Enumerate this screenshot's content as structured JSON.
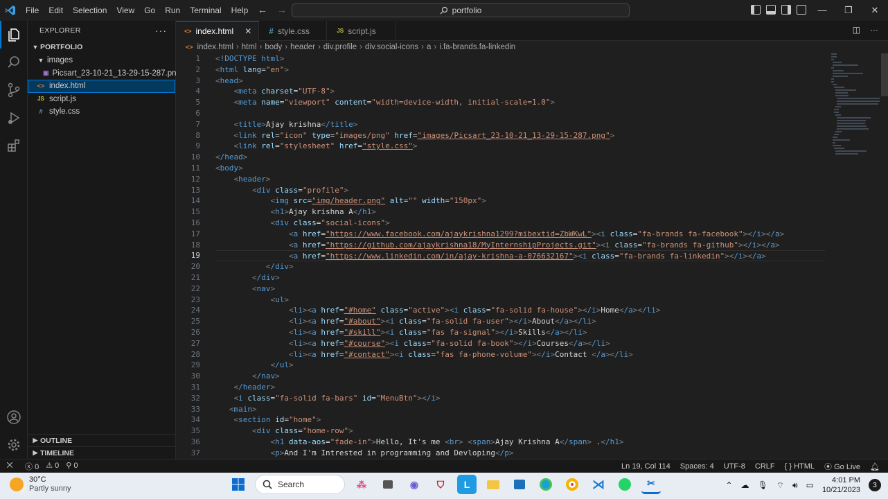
{
  "titlebar": {
    "menu": [
      "File",
      "Edit",
      "Selection",
      "View",
      "Go",
      "Run",
      "Terminal",
      "Help"
    ],
    "search_text": "portfolio"
  },
  "sidebar": {
    "title": "EXPLORER",
    "project": "PORTFOLIO",
    "folder_images": "images",
    "image_file": "Picsart_23-10-21_13-29-15-287.png",
    "files": [
      "index.html",
      "script.js",
      "style.css"
    ],
    "outline": "OUTLINE",
    "timeline": "TIMELINE"
  },
  "tabs": [
    {
      "label": "index.html",
      "icon": "html-file-icon"
    },
    {
      "label": "style.css",
      "icon": "css-file-icon"
    },
    {
      "label": "script.js",
      "icon": "js-file-icon"
    }
  ],
  "breadcrumbs": [
    "index.html",
    "html",
    "body",
    "header",
    "div.profile",
    "div.social-icons",
    "a",
    "i.fa-brands.fa-linkedin"
  ],
  "editor": {
    "current_line": 19,
    "lines": [
      "<!DOCTYPE html>",
      "<html lang=\"en\">",
      "<head>",
      "    <meta charset=\"UTF-8\">",
      "    <meta name=\"viewport\" content=\"width=device-width, initial-scale=1.0\">",
      "",
      "    <title>Ajay krishna</title>",
      "    <link rel=\"icon\" type=\"images/png\" href=\"images/Picsart_23-10-21_13-29-15-287.png\">",
      "    <link rel=\"stylesheet\" href=\"style.css\">",
      "</head>",
      "<body>",
      "    <header>",
      "        <div class=\"profile\">",
      "            <img src=\"img/header.png\" alt=\"\" width=\"150px\">",
      "            <h1>Ajay krishna A</h1>",
      "            <div class=\"social-icons\">",
      "                <a href=\"https://www.facebook.com/ajaykrishna1299?mibextid=ZbWKwL\"><i class=\"fa-brands fa-facebook\"></i></a>",
      "                <a href=\"https://github.com/ajaykrishna18/MyInternshipProjects.git\"><i class=\"fa-brands fa-github\"></i></a>",
      "                <a href=\"https://www.linkedin.com/in/ajay-krishna-a-076632167\"><i class=\"fa-brands fa-linkedin\"></i></a>",
      "           </div>",
      "        </div>",
      "        <nav>",
      "            <ul>",
      "                <li><a href=\"#home\" class=\"active\"><i class=\"fa-solid fa-house\"></i>Home</a></li>",
      "                <li><a href=\"#about\"><i class=\"fa-solid fa-user\"></i>About</a></li>",
      "                <li><a href=\"#skill\"><i class=\"fas fa-signal\"></i>Skills</a></li>",
      "                <li><a href=\"#course\"><i class=\"fa-solid fa-book\"></i>Courses</a></li>",
      "                <li><a href=\"#contact\"><i class=\"fas fa-phone-volume\"></i>Contact </a></li>",
      "            </ul>",
      "        </nav>",
      "    </header>",
      "    <i class=\"fa-solid fa-bars\" id=\"MenuBtn\"></i>",
      "   <main>",
      "    <section id=\"home\">",
      "        <div class=\"home-row\">",
      "            <h1 data-aos=\"fade-in\">Hello, It's me <br> <span>Ajay Krishna A</span> .</h1>",
      "            <p>And I'm Intrested in programming and Devloping</p>"
    ]
  },
  "statusbar": {
    "errors": "0",
    "warnings": "0",
    "ports": "0",
    "position": "Ln 19, Col 114",
    "spaces": "Spaces: 4",
    "encoding": "UTF-8",
    "eol": "CRLF",
    "language": "HTML",
    "golive": "Go Live"
  },
  "taskbar": {
    "temperature": "30°C",
    "weather": "Partly sunny",
    "search": "Search",
    "time": "4:01 PM",
    "date": "10/21/2023",
    "notifications": "3"
  },
  "colors": {
    "accent": "#0078d4",
    "tag": "#569cd6",
    "attr": "#9cdcfe",
    "string": "#ce9178"
  }
}
